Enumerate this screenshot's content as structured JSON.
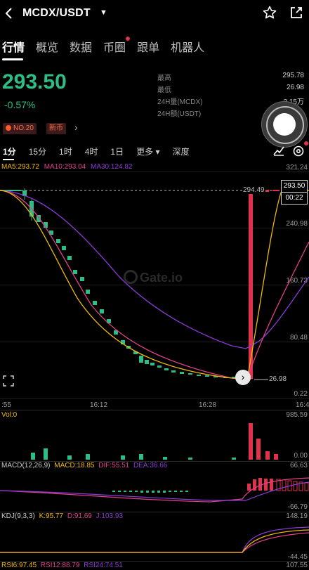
{
  "header": {
    "title": "MCDX/USDT",
    "dropdown_glyph": "▼",
    "back_icon": "chevron-left-icon",
    "star_icon": "star-icon",
    "share_icon": "share-icon"
  },
  "tabs": [
    {
      "label": "行情"
    },
    {
      "label": "概览"
    },
    {
      "label": "数据"
    },
    {
      "label": "币圈"
    },
    {
      "label": "跟单"
    },
    {
      "label": "机器人"
    }
  ],
  "ticker": {
    "price": "293.50",
    "change": "-0.57%",
    "price_color": "#2ebd85"
  },
  "stats": [
    {
      "label": "最高",
      "value": "295.78"
    },
    {
      "label": "最低",
      "value": "26.98"
    },
    {
      "label": "24H量(MCDX)",
      "value": "2.15万"
    },
    {
      "label": "24H额(USDT)",
      "value": ""
    }
  ],
  "badges": {
    "rank": "NO.20",
    "new": "新币",
    "more": "›"
  },
  "timeframes": [
    {
      "label": "1分"
    },
    {
      "label": "15分"
    },
    {
      "label": "1时"
    },
    {
      "label": "4时"
    },
    {
      "label": "1日"
    },
    {
      "label": "更多 ▾"
    },
    {
      "label": "深度"
    }
  ],
  "ma": {
    "ma5": "MA5:293.72",
    "ma10": "MA10:293.04",
    "ma30": "MA30:124.82"
  },
  "price_axis": [
    "321.24",
    "240.98",
    "160.73",
    "80.48",
    "0.22"
  ],
  "markers": {
    "high_dashed": "294.49",
    "low": "26.98",
    "last_price": "293.50",
    "countdown": "00:22"
  },
  "watermark": "Gate.io",
  "time_axis": [
    ":55",
    "16:12",
    "16:28",
    "16:4"
  ],
  "volume": {
    "label": "Vol:0",
    "max": "985.59",
    "min": "0.00"
  },
  "macd": {
    "label": "MACD(12,26,9)",
    "macd": "MACD:18.85",
    "dif": "DIF:55.51",
    "dea": "DEA:36.66",
    "max": "66.63",
    "min": "-66.79"
  },
  "kdj": {
    "label": "KDJ(9,3,3)",
    "k": "K:95.77",
    "d": "D:91.69",
    "j": "J:103.93",
    "max": "148.19",
    "min": "-44.45"
  },
  "rsi": {
    "rsi6": "RSI6:97.45",
    "rsi12": "RSI12:88.79",
    "rsi24": "RSI24:74.51",
    "max": "107.55"
  },
  "colors": {
    "up": "#2ebd85",
    "down": "#e0324a",
    "ma5": "#f0b90b",
    "ma10": "#e0408a",
    "ma30": "#8a3bd6"
  }
}
